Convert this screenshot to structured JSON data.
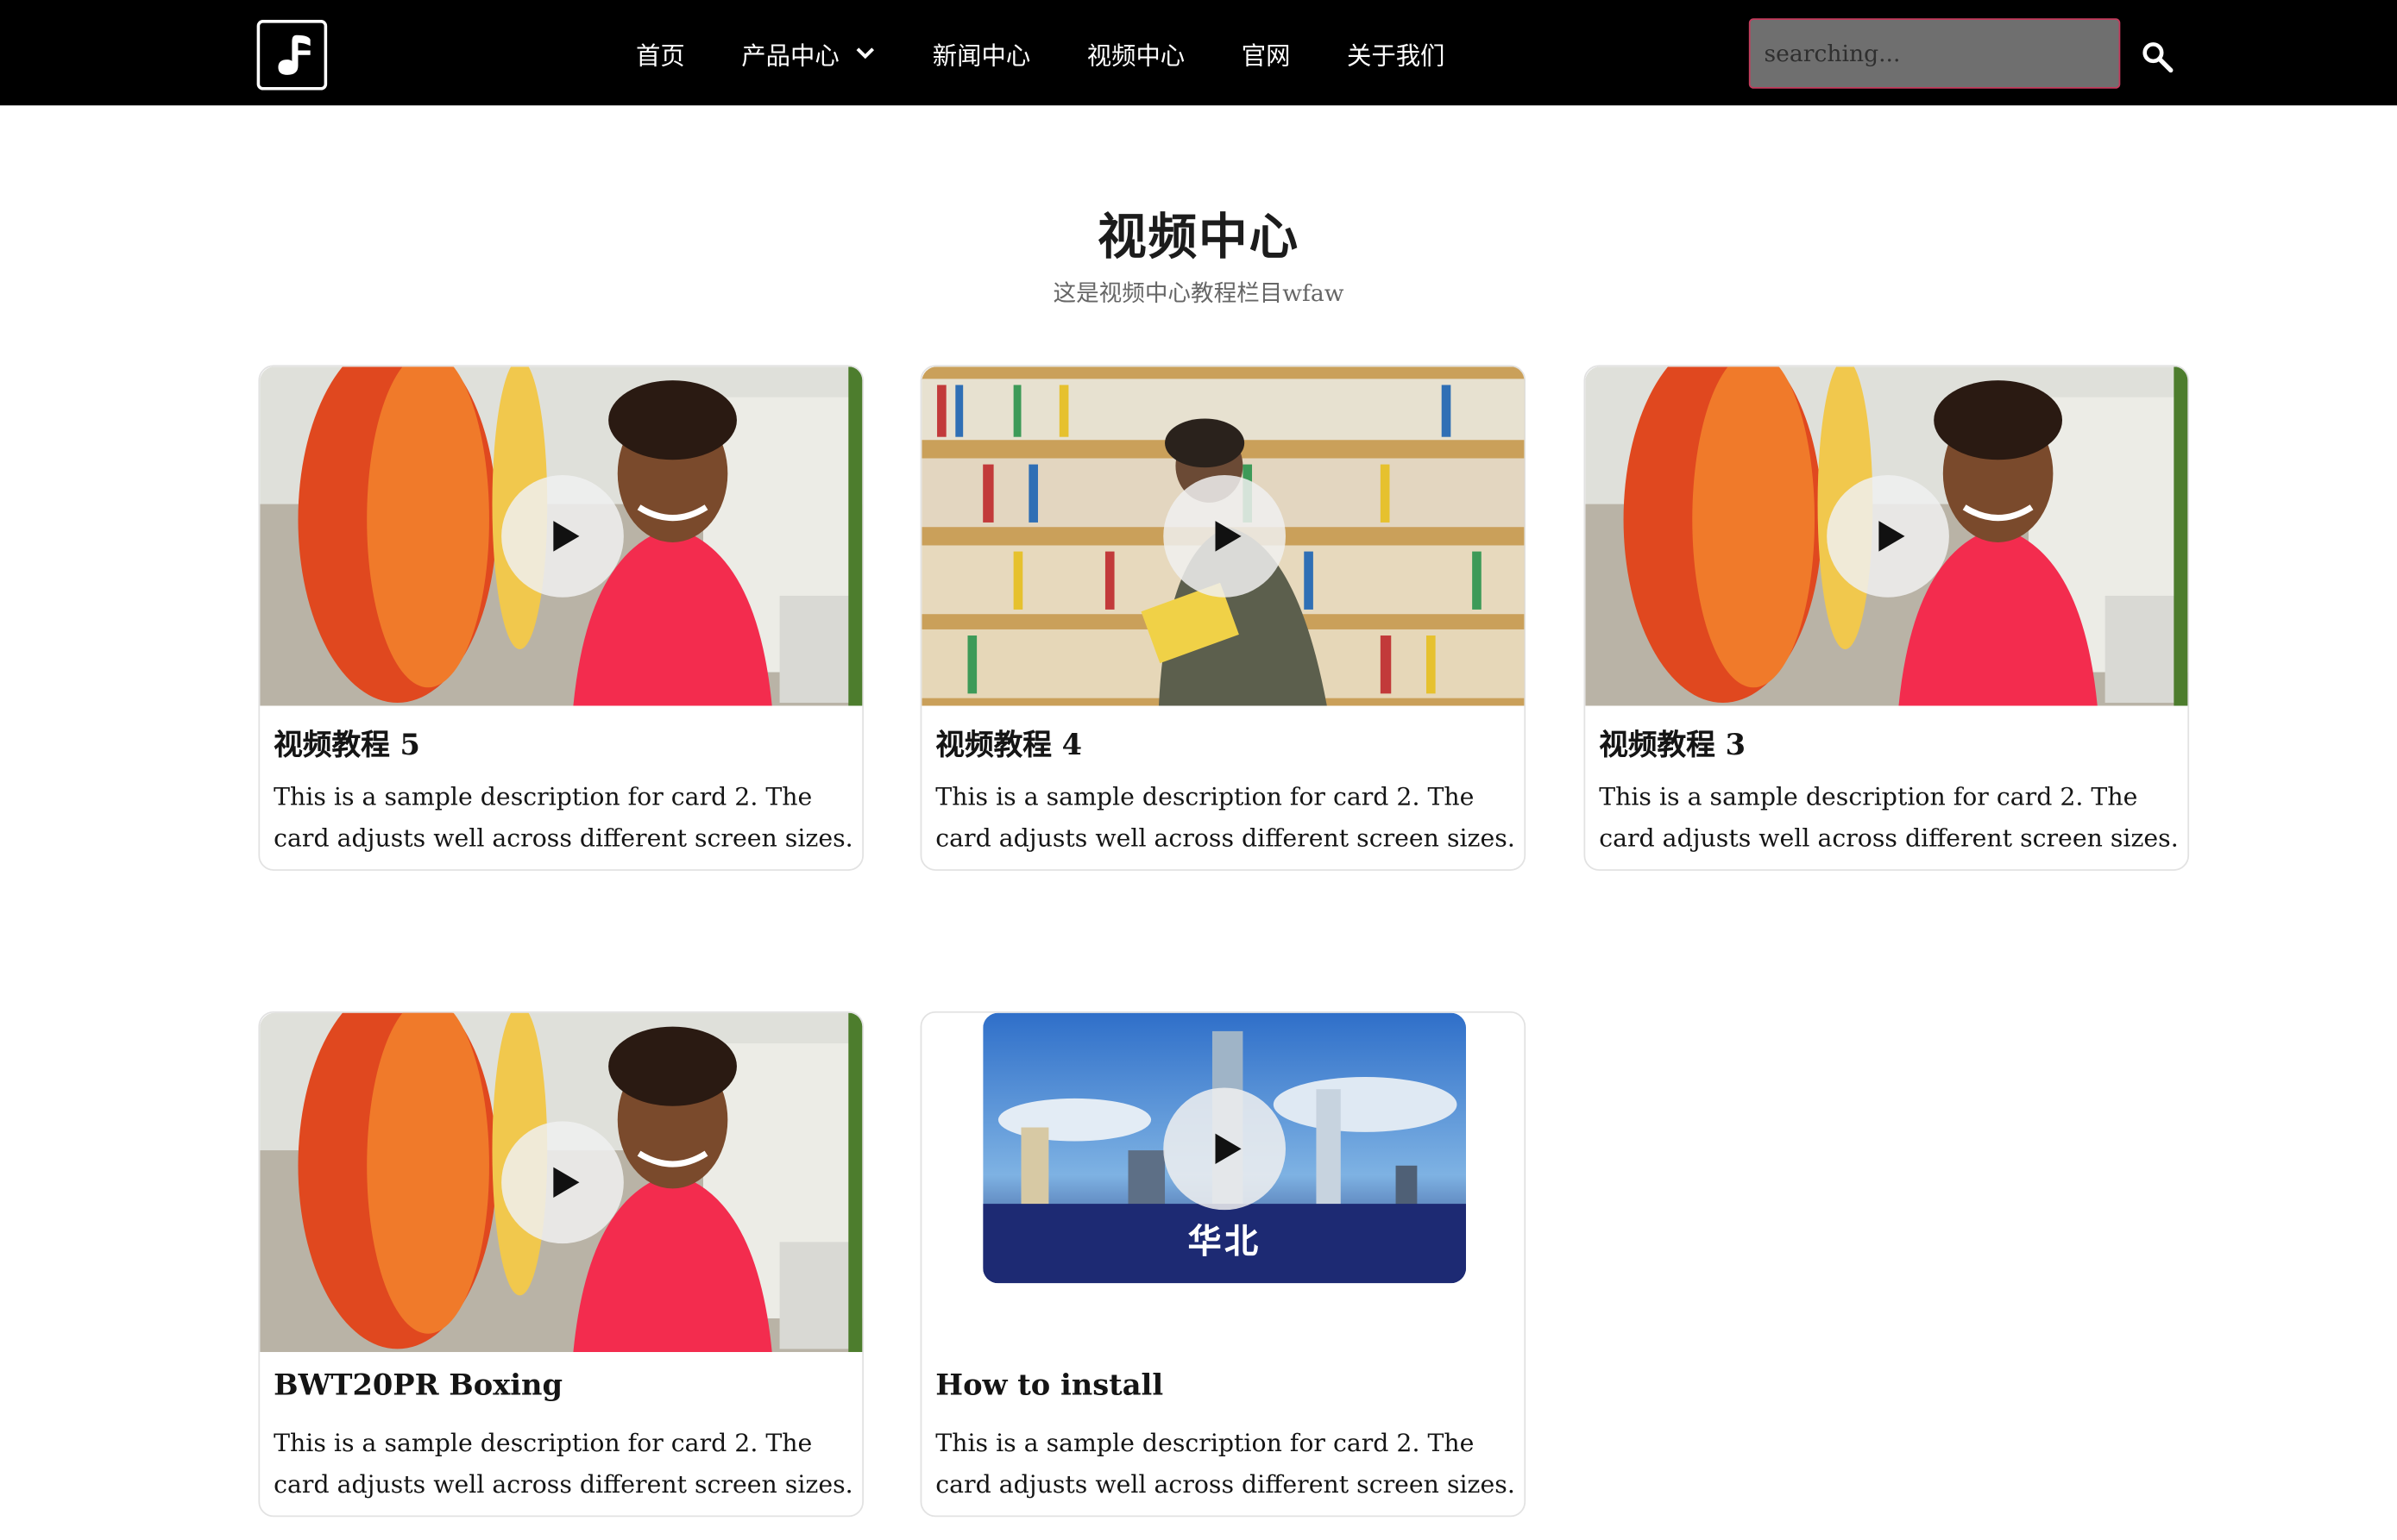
{
  "header": {
    "nav": [
      {
        "label": "首页"
      },
      {
        "label": "产品中心",
        "has_dropdown": true
      },
      {
        "label": "新闻中心"
      },
      {
        "label": "视频中心"
      },
      {
        "label": "官网"
      },
      {
        "label": "关于我们"
      }
    ],
    "search": {
      "placeholder": "searching..."
    }
  },
  "page": {
    "title": "视频中心",
    "subtitle": "这是视频中心教程栏目wfaw"
  },
  "cards": [
    {
      "title": "视频教程 5",
      "description": "This is a sample description for card 2. The card adjusts well across different screen sizes.",
      "thumbnail": "man-pink-shirt"
    },
    {
      "title": "视频教程 4",
      "description": "This is a sample description for card 2. The card adjusts well across different screen sizes.",
      "thumbnail": "man-bookshelf"
    },
    {
      "title": "视频教程 3",
      "description": "This is a sample description for card 2. The card adjusts well across different screen sizes.",
      "thumbnail": "man-pink-shirt"
    },
    {
      "title": "BWT20PR Boxing",
      "description": "This is a sample description for card 2. The card adjusts well across different screen sizes.",
      "thumbnail": "man-pink-shirt"
    },
    {
      "title": "How to install",
      "description": "This is a sample description for card 2. The card adjusts well across different screen sizes.",
      "thumbnail": "city-skyline",
      "thumbnail_caption": "华北"
    }
  ],
  "colors": {
    "header_bg": "#000000",
    "search_border": "#c43b5c",
    "card_border": "#e2e2e2"
  }
}
